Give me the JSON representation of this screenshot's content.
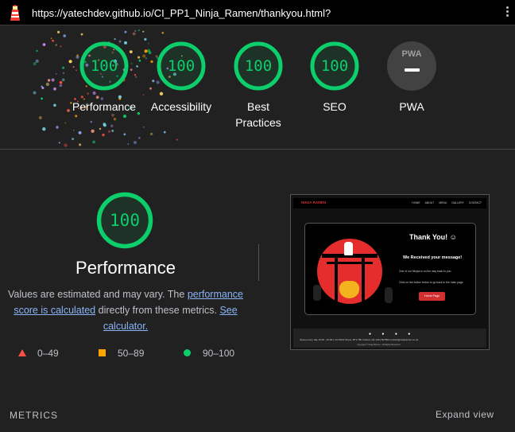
{
  "topbar": {
    "url": "https://yatechdev.github.io/CI_PP1_Ninja_Ramen/thankyou.html?",
    "logo_icon": "lighthouse-icon",
    "menu_icon": "kebab-menu-icon"
  },
  "colors": {
    "pass": "#0cce6b",
    "average": "#ffa400",
    "fail": "#ff4e42",
    "link": "#8ab4f8",
    "background": "#212121"
  },
  "gauges": [
    {
      "score": "100",
      "label": "Performance",
      "fraction": 1.0
    },
    {
      "score": "100",
      "label": "Accessibility",
      "fraction": 1.0
    },
    {
      "score": "100",
      "label": "Best\nPractices",
      "label_line1": "Best",
      "label_line2": "Practices",
      "fraction": 1.0
    },
    {
      "score": "100",
      "label": "SEO",
      "fraction": 1.0
    }
  ],
  "pwa": {
    "badge": "PWA",
    "label": "PWA"
  },
  "performance": {
    "score": "100",
    "fraction": 1.0,
    "title": "Performance",
    "desc_1": "Values are estimated and may vary. The ",
    "link_1": "performance score is calculated",
    "desc_2": " directly from these metrics. ",
    "link_2": "See calculator."
  },
  "legend": [
    {
      "range": "0–49",
      "shape": "triangle"
    },
    {
      "range": "50–89",
      "shape": "square"
    },
    {
      "range": "90–100",
      "shape": "circle"
    }
  ],
  "screenshot": {
    "brand": "NINJA RAMEN",
    "nav": [
      "HOME",
      "ABOUT",
      "MENU",
      "GALLERY",
      "CONTACT"
    ],
    "thank_you": "Thank You! ☺",
    "message": "We Received your message!",
    "line1": "One of our Ninjas is on the way back to you.",
    "line2": "Click on the button below to go back to the main page",
    "button": "Home Page",
    "footer_line": "Opens every day 10:00 - 22:00     1-1/4 Brick Street, BT2 7BL Ireland     +44 1234 567890     contact@ninjaramen.co.uk",
    "footer_copy": "Copyright © Ninja Ramen - All Rights Reserved"
  },
  "metrics": {
    "label": "METRICS",
    "expand": "Expand view"
  }
}
